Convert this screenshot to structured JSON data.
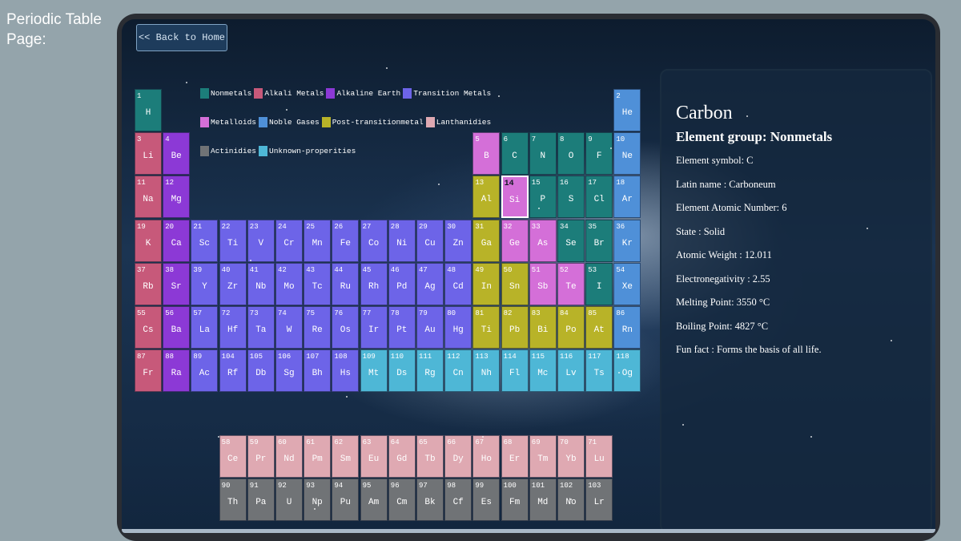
{
  "page_label": "Periodic Table Page:",
  "back_button": "<< Back to Home",
  "legend_rows": [
    [
      {
        "label": "Nonmetals",
        "color": "#1c7d7a"
      },
      {
        "label": "Alkali Metals",
        "color": "#c7597a"
      },
      {
        "label": "Alkaline Earth",
        "color": "#8c39d6"
      },
      {
        "label": "Transition Metals",
        "color": "#6d64e8"
      }
    ],
    [
      {
        "label": "Metalloids",
        "color": "#d46fd8"
      },
      {
        "label": "Noble Gases",
        "color": "#4f90d8"
      },
      {
        "label": "Post-transitionmetal",
        "color": "#b8b328"
      },
      {
        "label": "Lanthanidies",
        "color": "#dfa9b2"
      }
    ],
    [
      {
        "label": "Actinidies",
        "color": "#707376"
      },
      {
        "label": "Unknown-properities",
        "color": "#4eb7d6"
      }
    ]
  ],
  "category_colors": {
    "nm": "#1c7d7a",
    "al": "#c7597a",
    "ae": "#8c39d6",
    "tm": "#6d64e8",
    "md": "#d46fd8",
    "ng": "#4f90d8",
    "pt": "#b8b328",
    "la": "#dfa9b2",
    "ac": "#707376",
    "uk": "#4eb7d6"
  },
  "elements": [
    {
      "n": 1,
      "s": "H",
      "r": 1,
      "c": 1,
      "cat": "nm"
    },
    {
      "n": 2,
      "s": "He",
      "r": 1,
      "c": 18,
      "cat": "ng"
    },
    {
      "n": 3,
      "s": "Li",
      "r": 2,
      "c": 1,
      "cat": "al"
    },
    {
      "n": 4,
      "s": "Be",
      "r": 2,
      "c": 2,
      "cat": "ae"
    },
    {
      "n": 5,
      "s": "B",
      "r": 2,
      "c": 13,
      "cat": "md"
    },
    {
      "n": 6,
      "s": "C",
      "r": 2,
      "c": 14,
      "cat": "nm"
    },
    {
      "n": 7,
      "s": "N",
      "r": 2,
      "c": 15,
      "cat": "nm"
    },
    {
      "n": 8,
      "s": "O",
      "r": 2,
      "c": 16,
      "cat": "nm"
    },
    {
      "n": 9,
      "s": "F",
      "r": 2,
      "c": 17,
      "cat": "nm"
    },
    {
      "n": 10,
      "s": "Ne",
      "r": 2,
      "c": 18,
      "cat": "ng"
    },
    {
      "n": 11,
      "s": "Na",
      "r": 3,
      "c": 1,
      "cat": "al"
    },
    {
      "n": 12,
      "s": "Mg",
      "r": 3,
      "c": 2,
      "cat": "ae"
    },
    {
      "n": 13,
      "s": "Al",
      "r": 3,
      "c": 13,
      "cat": "pt"
    },
    {
      "n": 14,
      "s": "Si",
      "r": 3,
      "c": 14,
      "cat": "md",
      "selected": true
    },
    {
      "n": 15,
      "s": "P",
      "r": 3,
      "c": 15,
      "cat": "nm"
    },
    {
      "n": 16,
      "s": "S",
      "r": 3,
      "c": 16,
      "cat": "nm"
    },
    {
      "n": 17,
      "s": "Cl",
      "r": 3,
      "c": 17,
      "cat": "nm"
    },
    {
      "n": 18,
      "s": "Ar",
      "r": 3,
      "c": 18,
      "cat": "ng"
    },
    {
      "n": 19,
      "s": "K",
      "r": 4,
      "c": 1,
      "cat": "al"
    },
    {
      "n": 20,
      "s": "Ca",
      "r": 4,
      "c": 2,
      "cat": "ae"
    },
    {
      "n": 21,
      "s": "Sc",
      "r": 4,
      "c": 3,
      "cat": "tm"
    },
    {
      "n": 22,
      "s": "Ti",
      "r": 4,
      "c": 4,
      "cat": "tm"
    },
    {
      "n": 23,
      "s": "V",
      "r": 4,
      "c": 5,
      "cat": "tm"
    },
    {
      "n": 24,
      "s": "Cr",
      "r": 4,
      "c": 6,
      "cat": "tm"
    },
    {
      "n": 25,
      "s": "Mn",
      "r": 4,
      "c": 7,
      "cat": "tm"
    },
    {
      "n": 26,
      "s": "Fe",
      "r": 4,
      "c": 8,
      "cat": "tm"
    },
    {
      "n": 27,
      "s": "Co",
      "r": 4,
      "c": 9,
      "cat": "tm"
    },
    {
      "n": 28,
      "s": "Ni",
      "r": 4,
      "c": 10,
      "cat": "tm"
    },
    {
      "n": 29,
      "s": "Cu",
      "r": 4,
      "c": 11,
      "cat": "tm"
    },
    {
      "n": 30,
      "s": "Zn",
      "r": 4,
      "c": 12,
      "cat": "tm"
    },
    {
      "n": 31,
      "s": "Ga",
      "r": 4,
      "c": 13,
      "cat": "pt"
    },
    {
      "n": 32,
      "s": "Ge",
      "r": 4,
      "c": 14,
      "cat": "md"
    },
    {
      "n": 33,
      "s": "As",
      "r": 4,
      "c": 15,
      "cat": "md"
    },
    {
      "n": 34,
      "s": "Se",
      "r": 4,
      "c": 16,
      "cat": "nm"
    },
    {
      "n": 35,
      "s": "Br",
      "r": 4,
      "c": 17,
      "cat": "nm"
    },
    {
      "n": 36,
      "s": "Kr",
      "r": 4,
      "c": 18,
      "cat": "ng"
    },
    {
      "n": 37,
      "s": "Rb",
      "r": 5,
      "c": 1,
      "cat": "al"
    },
    {
      "n": 38,
      "s": "Sr",
      "r": 5,
      "c": 2,
      "cat": "ae"
    },
    {
      "n": 39,
      "s": "Y",
      "r": 5,
      "c": 3,
      "cat": "tm"
    },
    {
      "n": 40,
      "s": "Zr",
      "r": 5,
      "c": 4,
      "cat": "tm"
    },
    {
      "n": 41,
      "s": "Nb",
      "r": 5,
      "c": 5,
      "cat": "tm"
    },
    {
      "n": 42,
      "s": "Mo",
      "r": 5,
      "c": 6,
      "cat": "tm"
    },
    {
      "n": 43,
      "s": "Tc",
      "r": 5,
      "c": 7,
      "cat": "tm"
    },
    {
      "n": 44,
      "s": "Ru",
      "r": 5,
      "c": 8,
      "cat": "tm"
    },
    {
      "n": 45,
      "s": "Rh",
      "r": 5,
      "c": 9,
      "cat": "tm"
    },
    {
      "n": 46,
      "s": "Pd",
      "r": 5,
      "c": 10,
      "cat": "tm"
    },
    {
      "n": 47,
      "s": "Ag",
      "r": 5,
      "c": 11,
      "cat": "tm"
    },
    {
      "n": 48,
      "s": "Cd",
      "r": 5,
      "c": 12,
      "cat": "tm"
    },
    {
      "n": 49,
      "s": "In",
      "r": 5,
      "c": 13,
      "cat": "pt"
    },
    {
      "n": 50,
      "s": "Sn",
      "r": 5,
      "c": 14,
      "cat": "pt"
    },
    {
      "n": 51,
      "s": "Sb",
      "r": 5,
      "c": 15,
      "cat": "md"
    },
    {
      "n": 52,
      "s": "Te",
      "r": 5,
      "c": 16,
      "cat": "md"
    },
    {
      "n": 53,
      "s": "I",
      "r": 5,
      "c": 17,
      "cat": "nm"
    },
    {
      "n": 54,
      "s": "Xe",
      "r": 5,
      "c": 18,
      "cat": "ng"
    },
    {
      "n": 55,
      "s": "Cs",
      "r": 6,
      "c": 1,
      "cat": "al"
    },
    {
      "n": 56,
      "s": "Ba",
      "r": 6,
      "c": 2,
      "cat": "ae"
    },
    {
      "n": 57,
      "s": "La",
      "r": 6,
      "c": 3,
      "cat": "tm"
    },
    {
      "n": 72,
      "s": "Hf",
      "r": 6,
      "c": 4,
      "cat": "tm"
    },
    {
      "n": 73,
      "s": "Ta",
      "r": 6,
      "c": 5,
      "cat": "tm"
    },
    {
      "n": 74,
      "s": "W",
      "r": 6,
      "c": 6,
      "cat": "tm"
    },
    {
      "n": 75,
      "s": "Re",
      "r": 6,
      "c": 7,
      "cat": "tm"
    },
    {
      "n": 76,
      "s": "Os",
      "r": 6,
      "c": 8,
      "cat": "tm"
    },
    {
      "n": 77,
      "s": "Ir",
      "r": 6,
      "c": 9,
      "cat": "tm"
    },
    {
      "n": 78,
      "s": "Pt",
      "r": 6,
      "c": 10,
      "cat": "tm"
    },
    {
      "n": 79,
      "s": "Au",
      "r": 6,
      "c": 11,
      "cat": "tm"
    },
    {
      "n": 80,
      "s": "Hg",
      "r": 6,
      "c": 12,
      "cat": "tm"
    },
    {
      "n": 81,
      "s": "Ti",
      "r": 6,
      "c": 13,
      "cat": "pt"
    },
    {
      "n": 82,
      "s": "Pb",
      "r": 6,
      "c": 14,
      "cat": "pt"
    },
    {
      "n": 83,
      "s": "Bi",
      "r": 6,
      "c": 15,
      "cat": "pt"
    },
    {
      "n": 84,
      "s": "Po",
      "r": 6,
      "c": 16,
      "cat": "pt"
    },
    {
      "n": 85,
      "s": "At",
      "r": 6,
      "c": 17,
      "cat": "pt"
    },
    {
      "n": 86,
      "s": "Rn",
      "r": 6,
      "c": 18,
      "cat": "ng"
    },
    {
      "n": 87,
      "s": "Fr",
      "r": 7,
      "c": 1,
      "cat": "al"
    },
    {
      "n": 88,
      "s": "Ra",
      "r": 7,
      "c": 2,
      "cat": "ae"
    },
    {
      "n": 89,
      "s": "Ac",
      "r": 7,
      "c": 3,
      "cat": "tm"
    },
    {
      "n": 104,
      "s": "Rf",
      "r": 7,
      "c": 4,
      "cat": "tm"
    },
    {
      "n": 105,
      "s": "Db",
      "r": 7,
      "c": 5,
      "cat": "tm"
    },
    {
      "n": 106,
      "s": "Sg",
      "r": 7,
      "c": 6,
      "cat": "tm"
    },
    {
      "n": 107,
      "s": "Bh",
      "r": 7,
      "c": 7,
      "cat": "tm"
    },
    {
      "n": 108,
      "s": "Hs",
      "r": 7,
      "c": 8,
      "cat": "tm"
    },
    {
      "n": 109,
      "s": "Mt",
      "r": 7,
      "c": 9,
      "cat": "uk"
    },
    {
      "n": 110,
      "s": "Ds",
      "r": 7,
      "c": 10,
      "cat": "uk"
    },
    {
      "n": 111,
      "s": "Rg",
      "r": 7,
      "c": 11,
      "cat": "uk"
    },
    {
      "n": 112,
      "s": "Cn",
      "r": 7,
      "c": 12,
      "cat": "uk"
    },
    {
      "n": 113,
      "s": "Nh",
      "r": 7,
      "c": 13,
      "cat": "uk"
    },
    {
      "n": 114,
      "s": "Fl",
      "r": 7,
      "c": 14,
      "cat": "uk"
    },
    {
      "n": 115,
      "s": "Mc",
      "r": 7,
      "c": 15,
      "cat": "uk"
    },
    {
      "n": 116,
      "s": "Lv",
      "r": 7,
      "c": 16,
      "cat": "uk"
    },
    {
      "n": 117,
      "s": "Ts",
      "r": 7,
      "c": 17,
      "cat": "uk"
    },
    {
      "n": 118,
      "s": "Og",
      "r": 7,
      "c": 18,
      "cat": "uk"
    },
    {
      "n": 58,
      "s": "Ce",
      "r": 9,
      "c": 4,
      "cat": "la"
    },
    {
      "n": 59,
      "s": "Pr",
      "r": 9,
      "c": 5,
      "cat": "la"
    },
    {
      "n": 60,
      "s": "Nd",
      "r": 9,
      "c": 6,
      "cat": "la"
    },
    {
      "n": 61,
      "s": "Pm",
      "r": 9,
      "c": 7,
      "cat": "la"
    },
    {
      "n": 62,
      "s": "Sm",
      "r": 9,
      "c": 8,
      "cat": "la"
    },
    {
      "n": 63,
      "s": "Eu",
      "r": 9,
      "c": 9,
      "cat": "la"
    },
    {
      "n": 64,
      "s": "Gd",
      "r": 9,
      "c": 10,
      "cat": "la"
    },
    {
      "n": 65,
      "s": "Tb",
      "r": 9,
      "c": 11,
      "cat": "la"
    },
    {
      "n": 66,
      "s": "Dy",
      "r": 9,
      "c": 12,
      "cat": "la"
    },
    {
      "n": 67,
      "s": "Ho",
      "r": 9,
      "c": 13,
      "cat": "la"
    },
    {
      "n": 68,
      "s": "Er",
      "r": 9,
      "c": 14,
      "cat": "la"
    },
    {
      "n": 69,
      "s": "Tm",
      "r": 9,
      "c": 15,
      "cat": "la"
    },
    {
      "n": 70,
      "s": "Yb",
      "r": 9,
      "c": 16,
      "cat": "la"
    },
    {
      "n": 71,
      "s": "Lu",
      "r": 9,
      "c": 17,
      "cat": "la"
    },
    {
      "n": 90,
      "s": "Th",
      "r": 10,
      "c": 4,
      "cat": "ac"
    },
    {
      "n": 91,
      "s": "Pa",
      "r": 10,
      "c": 5,
      "cat": "ac"
    },
    {
      "n": 92,
      "s": "U",
      "r": 10,
      "c": 6,
      "cat": "ac"
    },
    {
      "n": 93,
      "s": "Np",
      "r": 10,
      "c": 7,
      "cat": "ac"
    },
    {
      "n": 94,
      "s": "Pu",
      "r": 10,
      "c": 8,
      "cat": "ac"
    },
    {
      "n": 95,
      "s": "Am",
      "r": 10,
      "c": 9,
      "cat": "ac"
    },
    {
      "n": 96,
      "s": "Cm",
      "r": 10,
      "c": 10,
      "cat": "ac"
    },
    {
      "n": 97,
      "s": "Bk",
      "r": 10,
      "c": 11,
      "cat": "ac"
    },
    {
      "n": 98,
      "s": "Cf",
      "r": 10,
      "c": 12,
      "cat": "ac"
    },
    {
      "n": 99,
      "s": "Es",
      "r": 10,
      "c": 13,
      "cat": "ac"
    },
    {
      "n": 100,
      "s": "Fm",
      "r": 10,
      "c": 14,
      "cat": "ac"
    },
    {
      "n": 101,
      "s": "Md",
      "r": 10,
      "c": 15,
      "cat": "ac"
    },
    {
      "n": 102,
      "s": "No",
      "r": 10,
      "c": 16,
      "cat": "ac"
    },
    {
      "n": 103,
      "s": "Lr",
      "r": 10,
      "c": 17,
      "cat": "ac"
    }
  ],
  "info": {
    "name": "Carbon",
    "group": "Element group: Nonmetals",
    "lines": [
      "Element symbol: C",
      "Latin name : Carboneum",
      "Element Atomic Number: 6",
      "State : Solid",
      "Atomic Weight : 12.011",
      "Electronegativity : 2.55",
      "Melting Point: 3550 °C",
      "Boiling Point: 4827 °C",
      "Fun fact : Forms the basis of all life."
    ]
  }
}
